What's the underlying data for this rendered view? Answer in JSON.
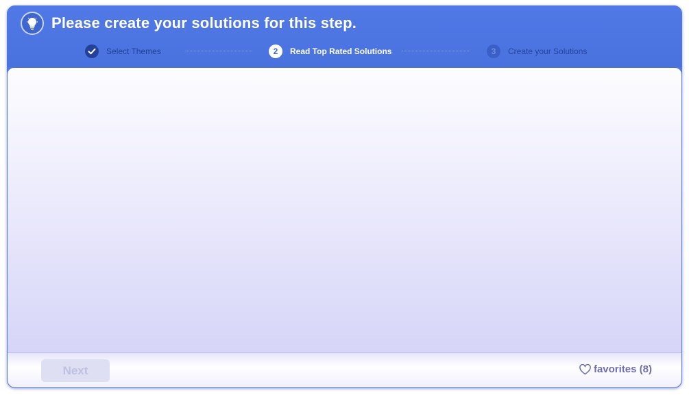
{
  "header": {
    "icon": "lightbulb-icon",
    "title": "Please create your solutions for this step."
  },
  "steps": [
    {
      "number": "",
      "icon": "check-icon",
      "label": "Select Themes",
      "state": "completed"
    },
    {
      "number": "2",
      "label": "Read Top Rated Solutions",
      "state": "current"
    },
    {
      "number": "3",
      "label": "Create your Solutions",
      "state": "upcoming"
    }
  ],
  "footer": {
    "next_label": "Next",
    "next_enabled": false,
    "favorites_icon": "heart-icon",
    "favorites_label": "favorites (8)"
  },
  "colors": {
    "header_blue": "#4f78e3",
    "completed_step": "#23409a",
    "accent_text": "#6d6fae"
  }
}
